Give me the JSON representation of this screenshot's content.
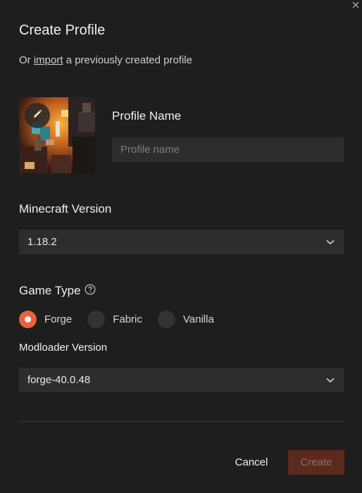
{
  "dialog": {
    "title": "Create Profile",
    "subtitle_prefix": "Or ",
    "subtitle_link": "import",
    "subtitle_suffix": " a previously created profile"
  },
  "profile_icon": {
    "icon": "pencil-icon"
  },
  "profile_name": {
    "label": "Profile Name",
    "placeholder": "Profile name",
    "value": ""
  },
  "minecraft_version": {
    "label": "Minecraft Version",
    "selected": "1.18.2"
  },
  "game_type": {
    "label": "Game Type",
    "options": [
      {
        "label": "Forge",
        "checked": true
      },
      {
        "label": "Fabric",
        "checked": false
      },
      {
        "label": "Vanilla",
        "checked": false
      }
    ]
  },
  "modloader_version": {
    "label": "Modloader Version",
    "selected": "forge-40.0.48"
  },
  "buttons": {
    "cancel": "Cancel",
    "create": "Create"
  },
  "colors": {
    "accent": "#e8623a",
    "create_disabled_bg": "#5a2a1e",
    "background": "#1e1e1e",
    "field_bg": "#2d2d2d"
  }
}
